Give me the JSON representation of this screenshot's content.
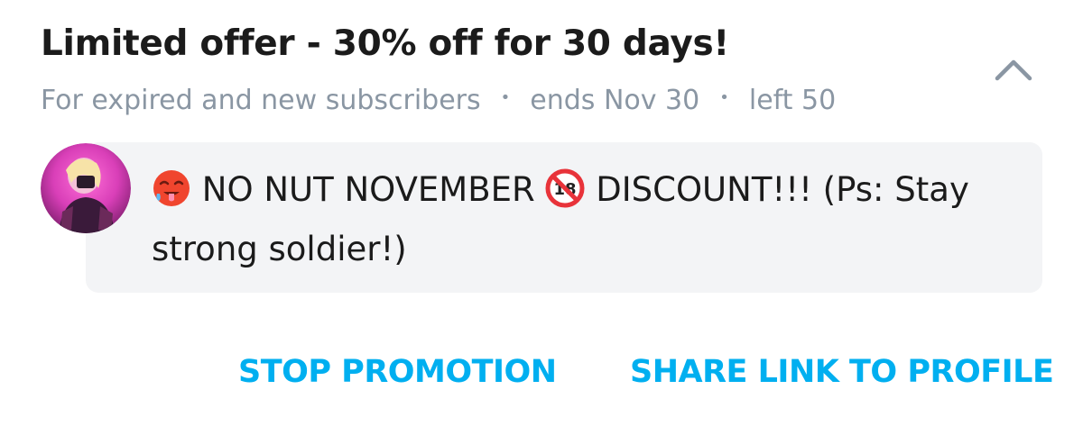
{
  "promotion": {
    "title": "Limited offer - 30% off for 30 days!",
    "audience": "For expired and new subscribers",
    "ends": "ends Nov 30",
    "left": "left 50",
    "separator": "•",
    "collapse_icon": "chevron-up-icon"
  },
  "message": {
    "emoji_1": "hot-face-emoji",
    "part_1": " NO NUT NOVEMBER ",
    "emoji_2": "no-one-under-18-emoji",
    "part_2": " DISCOUNT!!! (Ps: Stay strong soldier!)"
  },
  "actions": {
    "stop_label": "STOP PROMOTION",
    "share_label": "SHARE LINK TO PROFILE"
  },
  "colors": {
    "accent": "#00aff0",
    "muted": "#8a96a3",
    "bubble": "#f3f4f6",
    "text": "#1b1b1b"
  }
}
